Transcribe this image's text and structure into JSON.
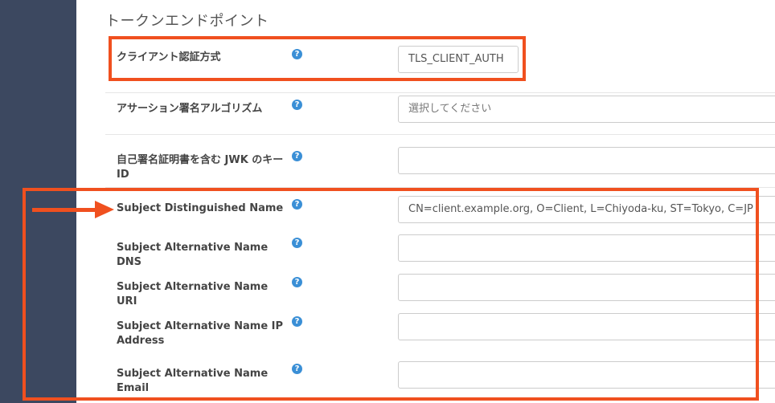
{
  "section": {
    "title": "トークンエンドポイント"
  },
  "fields": [
    {
      "label": "クライアント認証方式",
      "value": "TLS_CLIENT_AUTH",
      "placeholder": ""
    },
    {
      "label": "アサーション署名アルゴリズム",
      "value": "",
      "placeholder": "選択してください"
    },
    {
      "label": "自己署名証明書を含む JWK のキー ID",
      "value": "",
      "placeholder": ""
    },
    {
      "label": "Subject Distinguished Name",
      "value": "CN=client.example.org, O=Client, L=Chiyoda-ku, ST=Tokyo, C=JP",
      "placeholder": ""
    },
    {
      "label": "Subject Alternative Name DNS",
      "value": "",
      "placeholder": ""
    },
    {
      "label": "Subject Alternative Name URI",
      "value": "",
      "placeholder": ""
    },
    {
      "label": "Subject Alternative Name IP Address",
      "value": "",
      "placeholder": ""
    },
    {
      "label": "Subject Alternative Name Email",
      "value": "",
      "placeholder": ""
    }
  ],
  "help_icon": {
    "glyph": "?",
    "name": "question-circle-icon",
    "color": "#3a8fd6"
  },
  "annotation": {
    "color": "#f0501f"
  },
  "sidebar": {
    "color": "#3c4860"
  }
}
